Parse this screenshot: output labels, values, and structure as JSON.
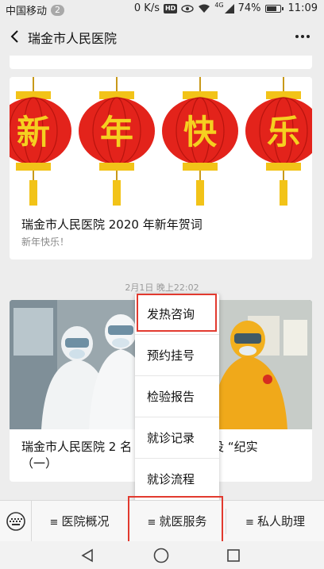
{
  "status_bar": {
    "carrier": "中国移动",
    "notification_count": "2",
    "speed": "0 K/s",
    "hd": "HD",
    "network": "4G",
    "battery": "74%",
    "battery_level": 0.74,
    "time": "11:09"
  },
  "nav": {
    "title": "瑞金市人民医院",
    "back_icon": "back-arrow-icon",
    "more_icon": "more-dots-icon"
  },
  "feed": {
    "card1": {
      "lantern_chars": [
        "新",
        "年",
        "快",
        "乐"
      ],
      "title": "瑞金市人民医院 2020 年新年贺词",
      "subtitle": "新年快乐！"
    },
    "timestamp": "2月1日 晚上22:02",
    "card2": {
      "title": "瑞金市人民医院 2 名",
      "title_tail": "战役 “纪实",
      "title_line2": "（一）"
    }
  },
  "popup_menu": {
    "items": [
      "发热咨询",
      "预约挂号",
      "检验报告",
      "就诊记录",
      "就诊流程"
    ],
    "highlighted_index": 0
  },
  "bottom_menu": {
    "keyboard_icon": "keyboard-icon",
    "items": [
      "医院概况",
      "就医服务",
      "私人助理"
    ],
    "highlighted_index": 1
  },
  "colors": {
    "highlight": "#e23a2f",
    "lantern_red": "#e3231b",
    "lantern_gold": "#f2c318",
    "char_color": "#f5d020"
  }
}
